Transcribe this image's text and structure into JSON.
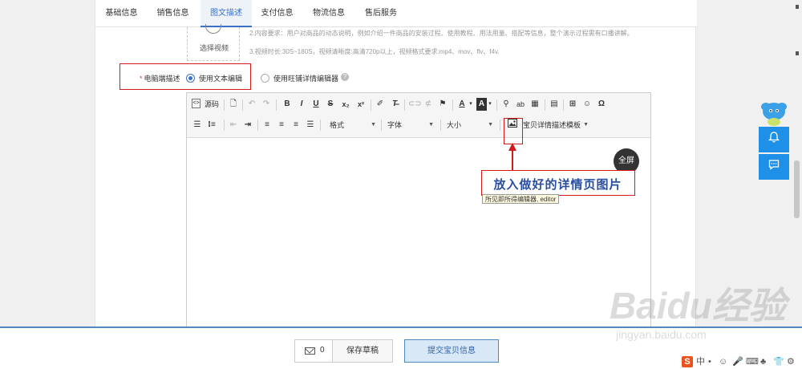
{
  "tabs": [
    {
      "label": "基础信息"
    },
    {
      "label": "销售信息"
    },
    {
      "label": "图文描述"
    },
    {
      "label": "支付信息"
    },
    {
      "label": "物流信息"
    },
    {
      "label": "售后服务"
    }
  ],
  "active_tab": "图文描述",
  "video": {
    "select_label": "选择视频",
    "requirements": [
      "2.内容要求：用户对商品的动态说明，例如介绍一件商品的安装过程、使用教程、用法用量、搭配等信息，整个演示过程需有口播讲解。",
      "3.视频时长:30S~180S，视频清晰度:高清720p以上，视频格式要求:mp4、mov、flv、f4v."
    ]
  },
  "pc_description": {
    "label": "电脑端描述",
    "required_mark": "*",
    "option_text_editor": "使用文本编辑",
    "option_wangpu_editor": "使用旺铺详情编辑器",
    "help_glyph": "?"
  },
  "toolbar": {
    "source_label": "源码",
    "bold": "B",
    "italic": "I",
    "underline": "U",
    "strike": "S",
    "subscript": "x₂",
    "superscript": "x²",
    "clear_format": "T̶",
    "text_color": "A",
    "bg_color": "A",
    "special_char": "Ω",
    "format_label": "格式",
    "font_label": "字体",
    "size_label": "大小",
    "template_label": "宝贝详情描述模板"
  },
  "editor": {
    "fullscreen_label": "全屏",
    "callout_text": "放入做好的详情页图片",
    "tooltip_text": "所见即所得编辑器, editor"
  },
  "bottom_bar": {
    "message_count": "0",
    "save_draft_label": "保存草稿",
    "submit_label": "提交宝贝信息"
  },
  "watermark": {
    "main": "Baidu经验",
    "sub": "jingyan.baidu.com"
  },
  "ime": {
    "logo": "S",
    "items": [
      "中",
      "•",
      "☺",
      "🎤",
      "⌨",
      "♣",
      "👕",
      "⚙"
    ]
  },
  "colors": {
    "accent": "#3a70c6",
    "annotation_red": "#d11a1a",
    "side_blue": "#1e90e8",
    "bottom_border": "#4e89c0"
  }
}
